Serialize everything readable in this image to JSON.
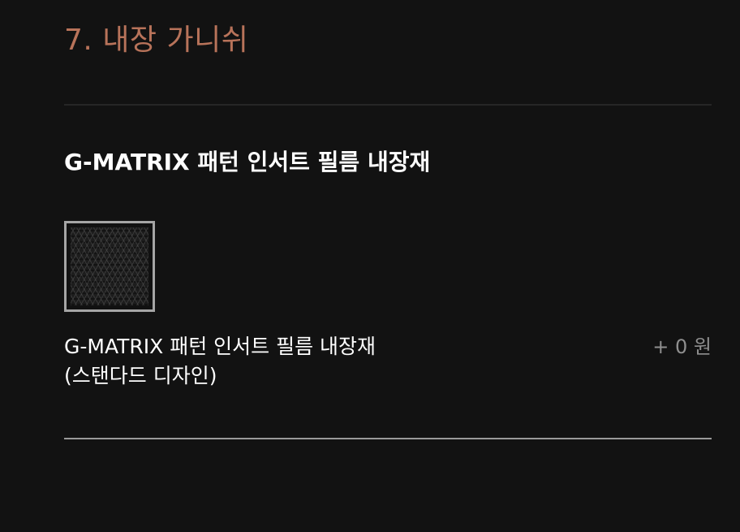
{
  "section": {
    "title": "7. 내장 가니쉬"
  },
  "option_group": {
    "title": "G-MATRIX 패턴 인서트 필름 내장재"
  },
  "options": [
    {
      "label_line1": "G-MATRIX 패턴 인서트 필름 내장재",
      "label_line2": "(스탠다드 디자인)",
      "price": "+ 0 원",
      "selected": true,
      "swatch_icon": "g-matrix-pattern-swatch"
    }
  ],
  "colors": {
    "background": "#121212",
    "accent": "#b8735a",
    "text": "#ffffff",
    "muted": "#8f8f8f",
    "selected_border": "#a5a5a5"
  }
}
